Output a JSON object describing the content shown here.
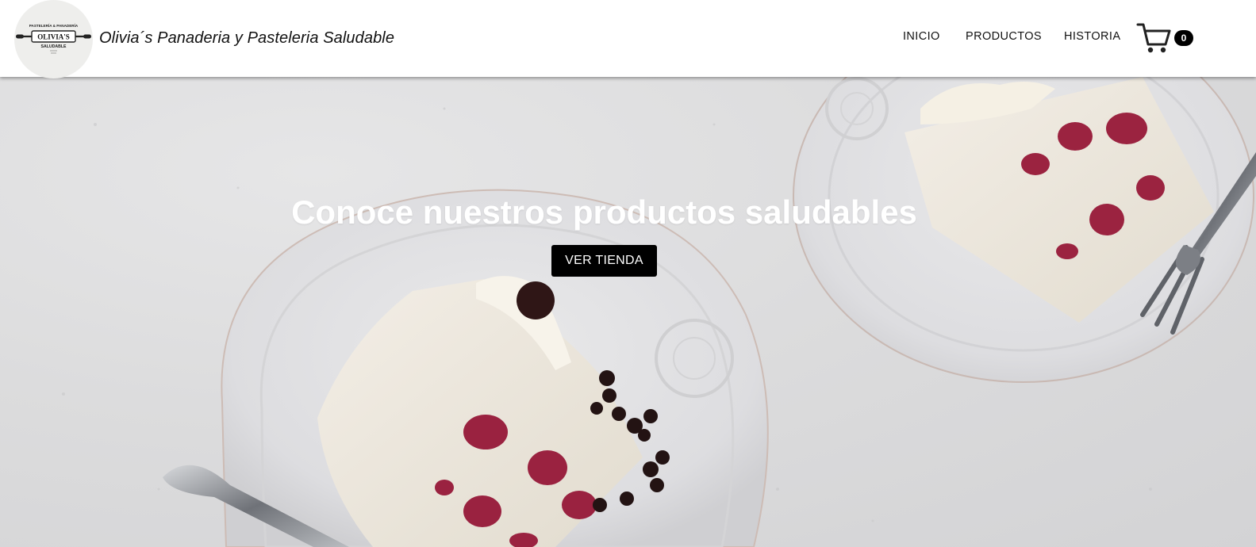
{
  "brand": {
    "name": "Olivia´s Panaderia y Pasteleria Saludable",
    "logo_top_text": "PASTELERÍA & PANADERÍA",
    "logo_main_text": "OLIVIA'S",
    "logo_sub_text": "SALUDABLE",
    "logo_icon": "rolling-pin-logo"
  },
  "nav": {
    "items": [
      {
        "label": "INICIO"
      },
      {
        "label": "PRODUCTOS"
      },
      {
        "label": "HISTORIA"
      }
    ],
    "cart": {
      "icon": "cart-icon",
      "count": "0"
    }
  },
  "hero": {
    "title": "Conoce nuestros productos saludables",
    "button_label": "VER TIENDA",
    "image": "cake-slices-on-plates"
  },
  "colors": {
    "header_bg": "#ffffff",
    "text": "#111111",
    "button_bg": "#000000",
    "button_text": "#ffffff",
    "badge_bg": "#000000"
  }
}
